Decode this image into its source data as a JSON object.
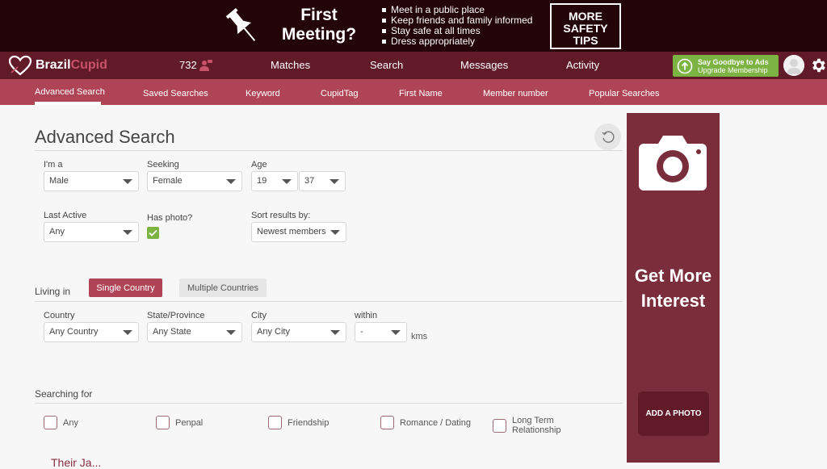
{
  "ad_banner": {
    "title": "First Meeting?",
    "tips": [
      "Meet in a public place",
      "Keep friends and family informed",
      "Stay safe at all times",
      "Dress appropriately"
    ],
    "cta_label": "MORE SAFETY TIPS",
    "icon": "pushpin-icon"
  },
  "topnav": {
    "logo_part1": "Brazil",
    "logo_part2": "Cupid",
    "online_count": "732",
    "links": [
      "Matches",
      "Search",
      "Messages",
      "Activity"
    ],
    "upgrade_line1": "Say Goodbye to Ads",
    "upgrade_line2": "Upgrade Membership",
    "colors": {
      "nav_bg": "#611a27",
      "subnav_bg": "#b04457",
      "upgrade_bg": "#7cb342",
      "banner_bg": "#230408"
    }
  },
  "subnav": {
    "tabs": [
      "Advanced Search",
      "Saved Searches",
      "Keyword",
      "CupidTag",
      "First Name",
      "Member number",
      "Popular Searches"
    ],
    "active": "Advanced Search"
  },
  "main": {
    "title": "Advanced Search",
    "fields": {
      "im_a": {
        "label": "I'm a",
        "value": "Male"
      },
      "seeking": {
        "label": "Seeking",
        "value": "Female"
      },
      "age": {
        "label": "Age",
        "min": "19",
        "max": "37"
      },
      "last_active": {
        "label": "Last Active",
        "value": "Any"
      },
      "has_photo": {
        "label": "Has photo?",
        "checked": true
      },
      "sort": {
        "label": "Sort results by:",
        "value": "Newest members"
      }
    },
    "living_in": {
      "title": "Living in",
      "single_label": "Single Country",
      "multiple_label": "Multiple Countries",
      "country": {
        "label": "Country",
        "value": "Any Country"
      },
      "state": {
        "label": "State/Province",
        "value": "Any State"
      },
      "city": {
        "label": "City",
        "value": "Any City"
      },
      "within": {
        "label": "within",
        "value": "-",
        "unit": "kms"
      }
    },
    "searching_for": {
      "title": "Searching for",
      "options": [
        "Any",
        "Penpal",
        "Friendship",
        "Romance / Dating",
        "Long Term Relationship"
      ]
    },
    "cut_off_heading": "Their Ja..."
  },
  "side_ad": {
    "text": "Get More Interest",
    "button_label": "ADD A PHOTO",
    "bg": "#7a2d3a"
  }
}
